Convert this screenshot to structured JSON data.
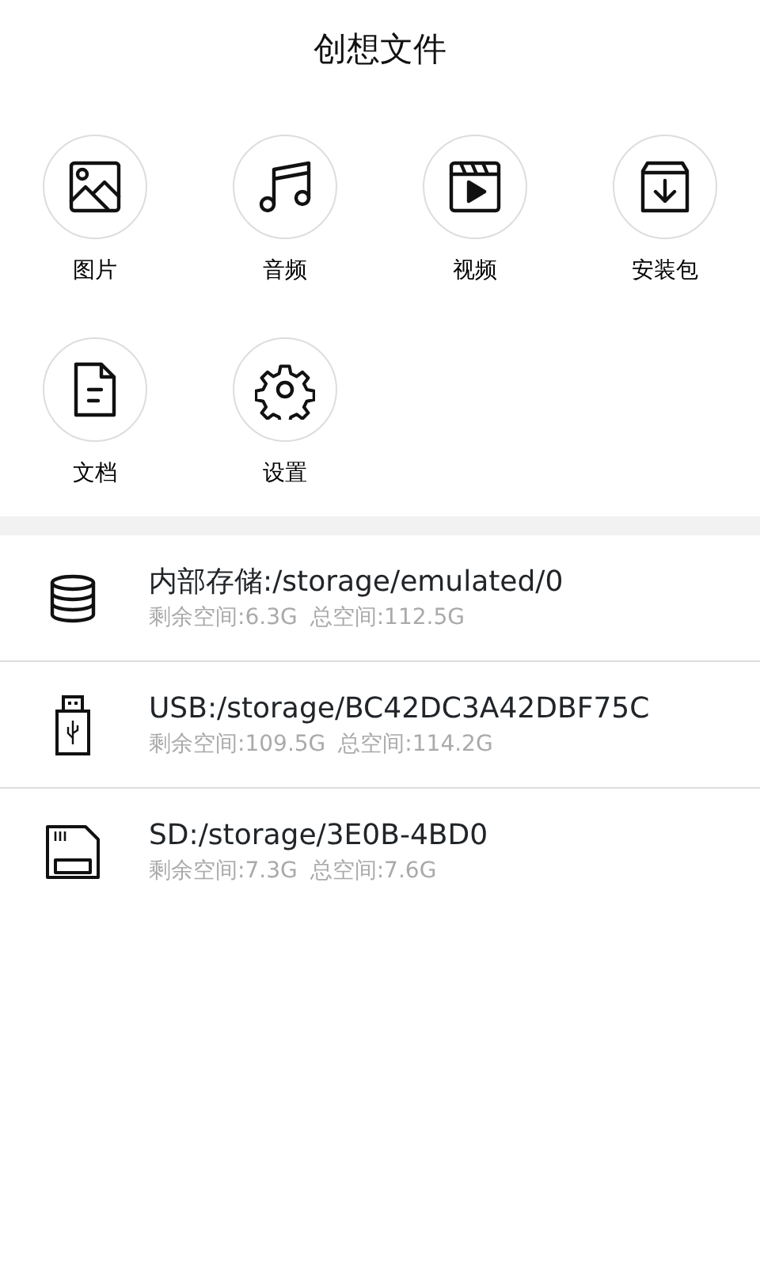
{
  "title": "创想文件",
  "categories": [
    {
      "kind": "image",
      "label": "图片"
    },
    {
      "kind": "music",
      "label": "音频"
    },
    {
      "kind": "video",
      "label": "视频"
    },
    {
      "kind": "package",
      "label": "安装包"
    },
    {
      "kind": "document",
      "label": "文档"
    },
    {
      "kind": "settings",
      "label": "设置"
    }
  ],
  "storages": [
    {
      "kind": "internal",
      "path": "内部存储:/storage/emulated/0",
      "free": "剩余空间:6.3G",
      "total": "总空间:112.5G"
    },
    {
      "kind": "usb",
      "path": "USB:/storage/BC42DC3A42DBF75C",
      "free": "剩余空间:109.5G",
      "total": "总空间:114.2G"
    },
    {
      "kind": "sd",
      "path": "SD:/storage/3E0B-4BD0",
      "free": "剩余空间:7.3G",
      "total": "总空间:7.6G"
    }
  ]
}
